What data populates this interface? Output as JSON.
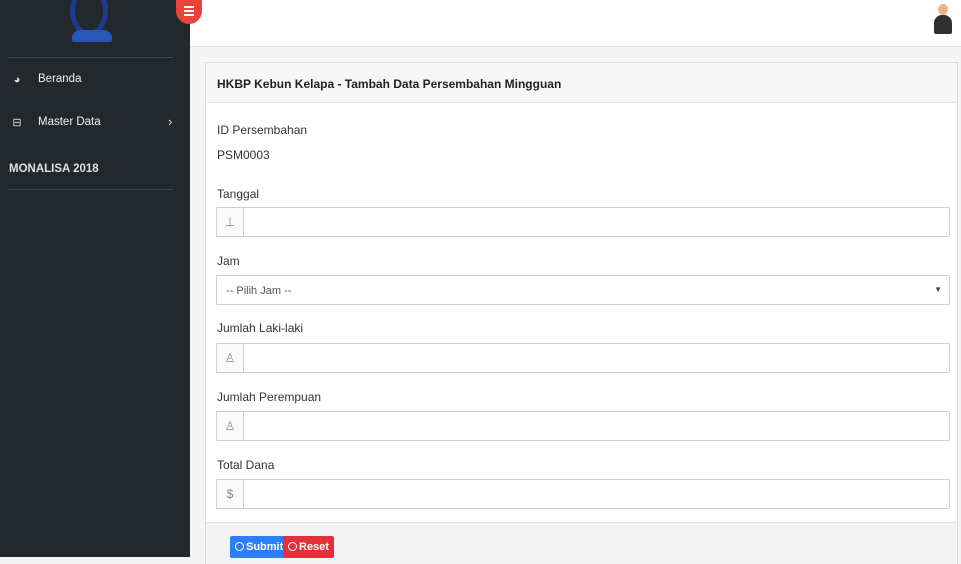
{
  "sidebar": {
    "menu": [
      {
        "label": "Beranda",
        "icon": "dashboard-icon"
      },
      {
        "label": "Master Data",
        "icon": "archive-icon",
        "chevron": "›"
      }
    ],
    "section_heading": "MONALISA 2018"
  },
  "panel": {
    "title": "HKBP Kebun Kelapa - Tambah Data Persembahan Mingguan"
  },
  "form": {
    "id_label": "ID Persembahan",
    "id_value": "PSM0003",
    "tanggal_label": "Tanggal",
    "tanggal_value": "",
    "jam_label": "Jam",
    "jam_selected": "-- Pilih Jam --",
    "laki_label": "Jumlah Laki-laki",
    "laki_value": "",
    "perempuan_label": "Jumlah Perempuan",
    "perempuan_value": "",
    "dana_label": "Total Dana",
    "dana_value": "",
    "dana_prefix": "$"
  },
  "buttons": {
    "submit_label": "Submit",
    "reset_label": "Reset"
  },
  "colors": {
    "sidebar_bg": "#23282d",
    "submit": "#2d7ff9",
    "reset": "#e3303b",
    "toggle": "#e8443a"
  }
}
